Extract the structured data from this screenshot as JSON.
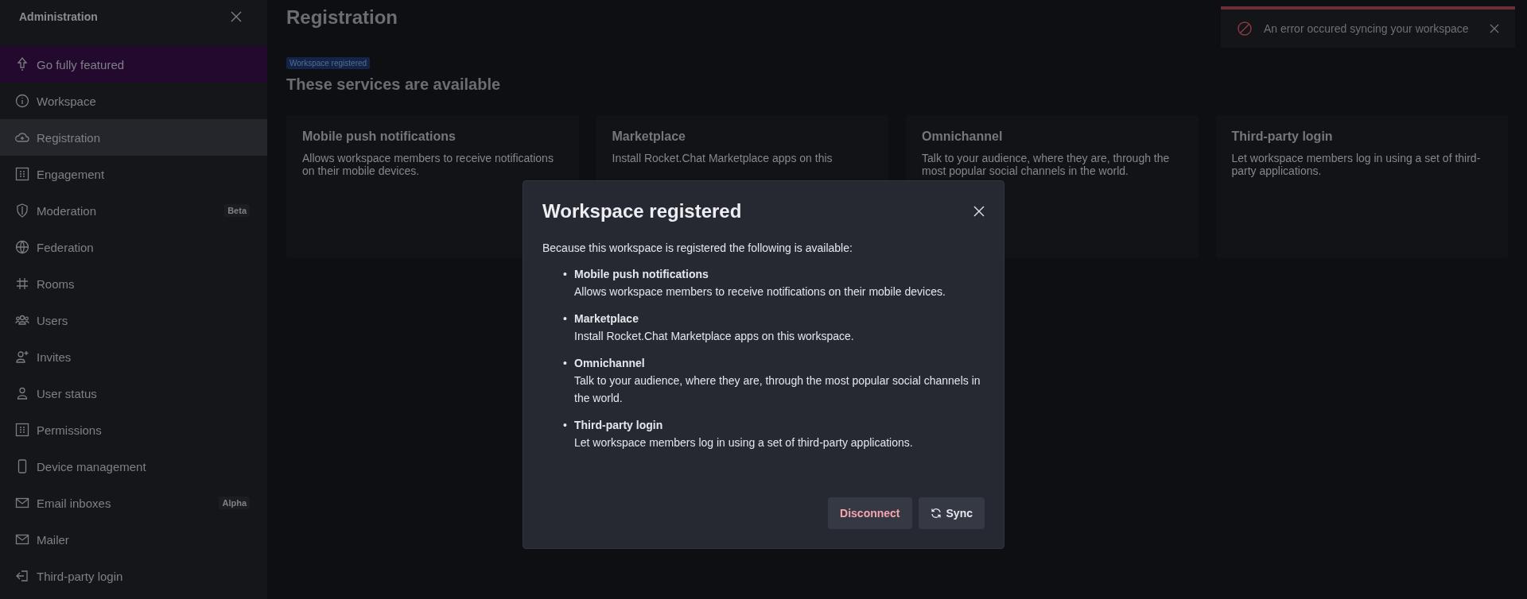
{
  "sidebar": {
    "title": "Administration",
    "items": [
      {
        "label": "Go fully featured",
        "kind": "promo",
        "selected": false
      },
      {
        "label": "Workspace",
        "kind": "link",
        "selected": false
      },
      {
        "label": "Registration",
        "kind": "link",
        "selected": true
      },
      {
        "label": "Engagement",
        "kind": "link",
        "selected": false
      },
      {
        "label": "Moderation",
        "kind": "link",
        "selected": false,
        "badge": "Beta"
      },
      {
        "label": "Federation",
        "kind": "link",
        "selected": false
      },
      {
        "label": "Rooms",
        "kind": "link",
        "selected": false
      },
      {
        "label": "Users",
        "kind": "link",
        "selected": false
      },
      {
        "label": "Invites",
        "kind": "link",
        "selected": false
      },
      {
        "label": "User status",
        "kind": "link",
        "selected": false
      },
      {
        "label": "Permissions",
        "kind": "link",
        "selected": false
      },
      {
        "label": "Device management",
        "kind": "link",
        "selected": false
      },
      {
        "label": "Email inboxes",
        "kind": "link",
        "selected": false,
        "badge": "Alpha"
      },
      {
        "label": "Mailer",
        "kind": "link",
        "selected": false
      },
      {
        "label": "Third-party login",
        "kind": "link",
        "selected": false
      }
    ]
  },
  "page": {
    "title": "Registration",
    "tag": "Workspace registered",
    "heading": "These services are available",
    "cards": [
      {
        "title": "Mobile push notifications",
        "text": "Allows workspace members to receive notifications on their mobile devices."
      },
      {
        "title": "Marketplace",
        "text": "Install Rocket.Chat Marketplace apps on this"
      },
      {
        "title": "Omnichannel",
        "text": "Talk to your audience, where they are, through the most popular social channels in the world."
      },
      {
        "title": "Third-party login",
        "text": "Let workspace members log in using a set of third-party applications."
      }
    ]
  },
  "toast": {
    "message": "An error occured syncing your workspace"
  },
  "modal": {
    "title": "Workspace registered",
    "intro": "Because this workspace is registered the following is available:",
    "services": [
      {
        "bullet": "•",
        "name": "Mobile push notifications",
        "text": "Allows workspace members to receive notifications on their mobile devices."
      },
      {
        "bullet": "•",
        "name": "Marketplace",
        "text": "Install Rocket.Chat Marketplace apps on this workspace."
      },
      {
        "bullet": "•",
        "name": "Omnichannel",
        "text": "Talk to your audience, where they are, through the most popular social channels in the world."
      },
      {
        "bullet": "•",
        "name": "Third-party login",
        "text": "Let workspace members log in using a set of third-party applications."
      }
    ],
    "buttons": [
      {
        "label": "Disconnect",
        "kind": "danger"
      },
      {
        "label": "Sync",
        "kind": "sync"
      }
    ]
  }
}
